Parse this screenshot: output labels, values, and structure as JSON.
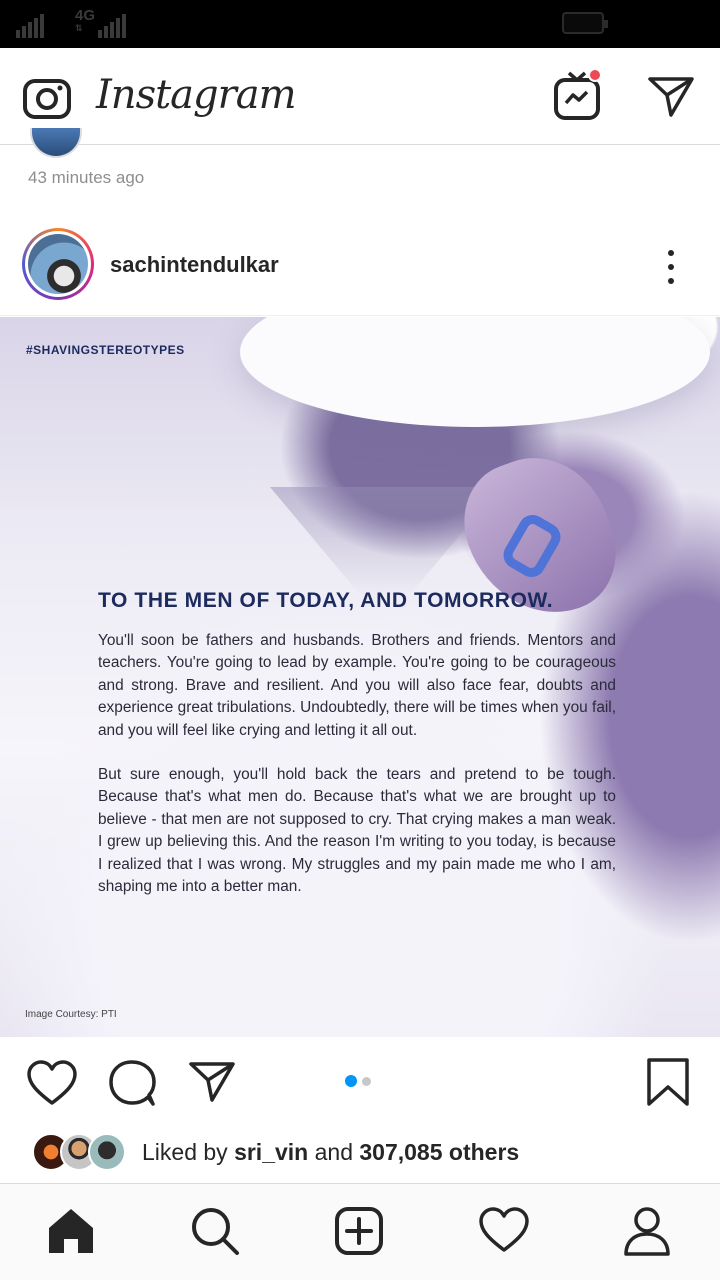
{
  "status_bar": {
    "network": "4G"
  },
  "header": {
    "brand": "Instagram",
    "camera_icon": "camera-icon",
    "igtv_icon": "igtv-icon",
    "direct_icon": "paper-plane-icon"
  },
  "previous_post": {
    "timestamp": "43 minutes ago"
  },
  "post": {
    "username": "sachintendulkar",
    "image": {
      "hashtag": "#SHAVINGSTEREOTYPES",
      "headline": "TO THE MEN OF TODAY, AND TOMORROW.",
      "paragraph1": "You'll soon be fathers and husbands. Brothers and friends. Mentors and teachers. You're going to lead by example. You're going to be courageous and strong. Brave and resilient. And you will also face fear, doubts and experience great tribulations. Undoubtedly, there will be times when you fail, and you will feel like crying and letting it all out.",
      "paragraph2": "But sure enough, you'll hold back the tears and pretend to be tough. Because that's what men do. Because that's what we are brought up to believe - that men are not supposed to cry. That crying makes a man weak. I grew up believing this. And the reason I'm writing to you today, is because I realized that I was wrong. My struggles and my pain made me who I am, shaping me into a better man.",
      "credit": "Image Courtesy: PTI"
    },
    "carousel": {
      "current": 1,
      "total": 2
    },
    "likes": {
      "prefix": "Liked by ",
      "user": "sri_vin",
      "middle": " and ",
      "count": "307,085 others"
    }
  },
  "colors": {
    "accent_blue": "#0095f6",
    "notification_red": "#ed4956",
    "text_primary": "#262626",
    "text_secondary": "#8e8e8e",
    "poster_navy": "#1c2a5e"
  },
  "bottom_nav": [
    "home-icon",
    "search-icon",
    "new-post-icon",
    "activity-heart-icon",
    "profile-icon"
  ]
}
